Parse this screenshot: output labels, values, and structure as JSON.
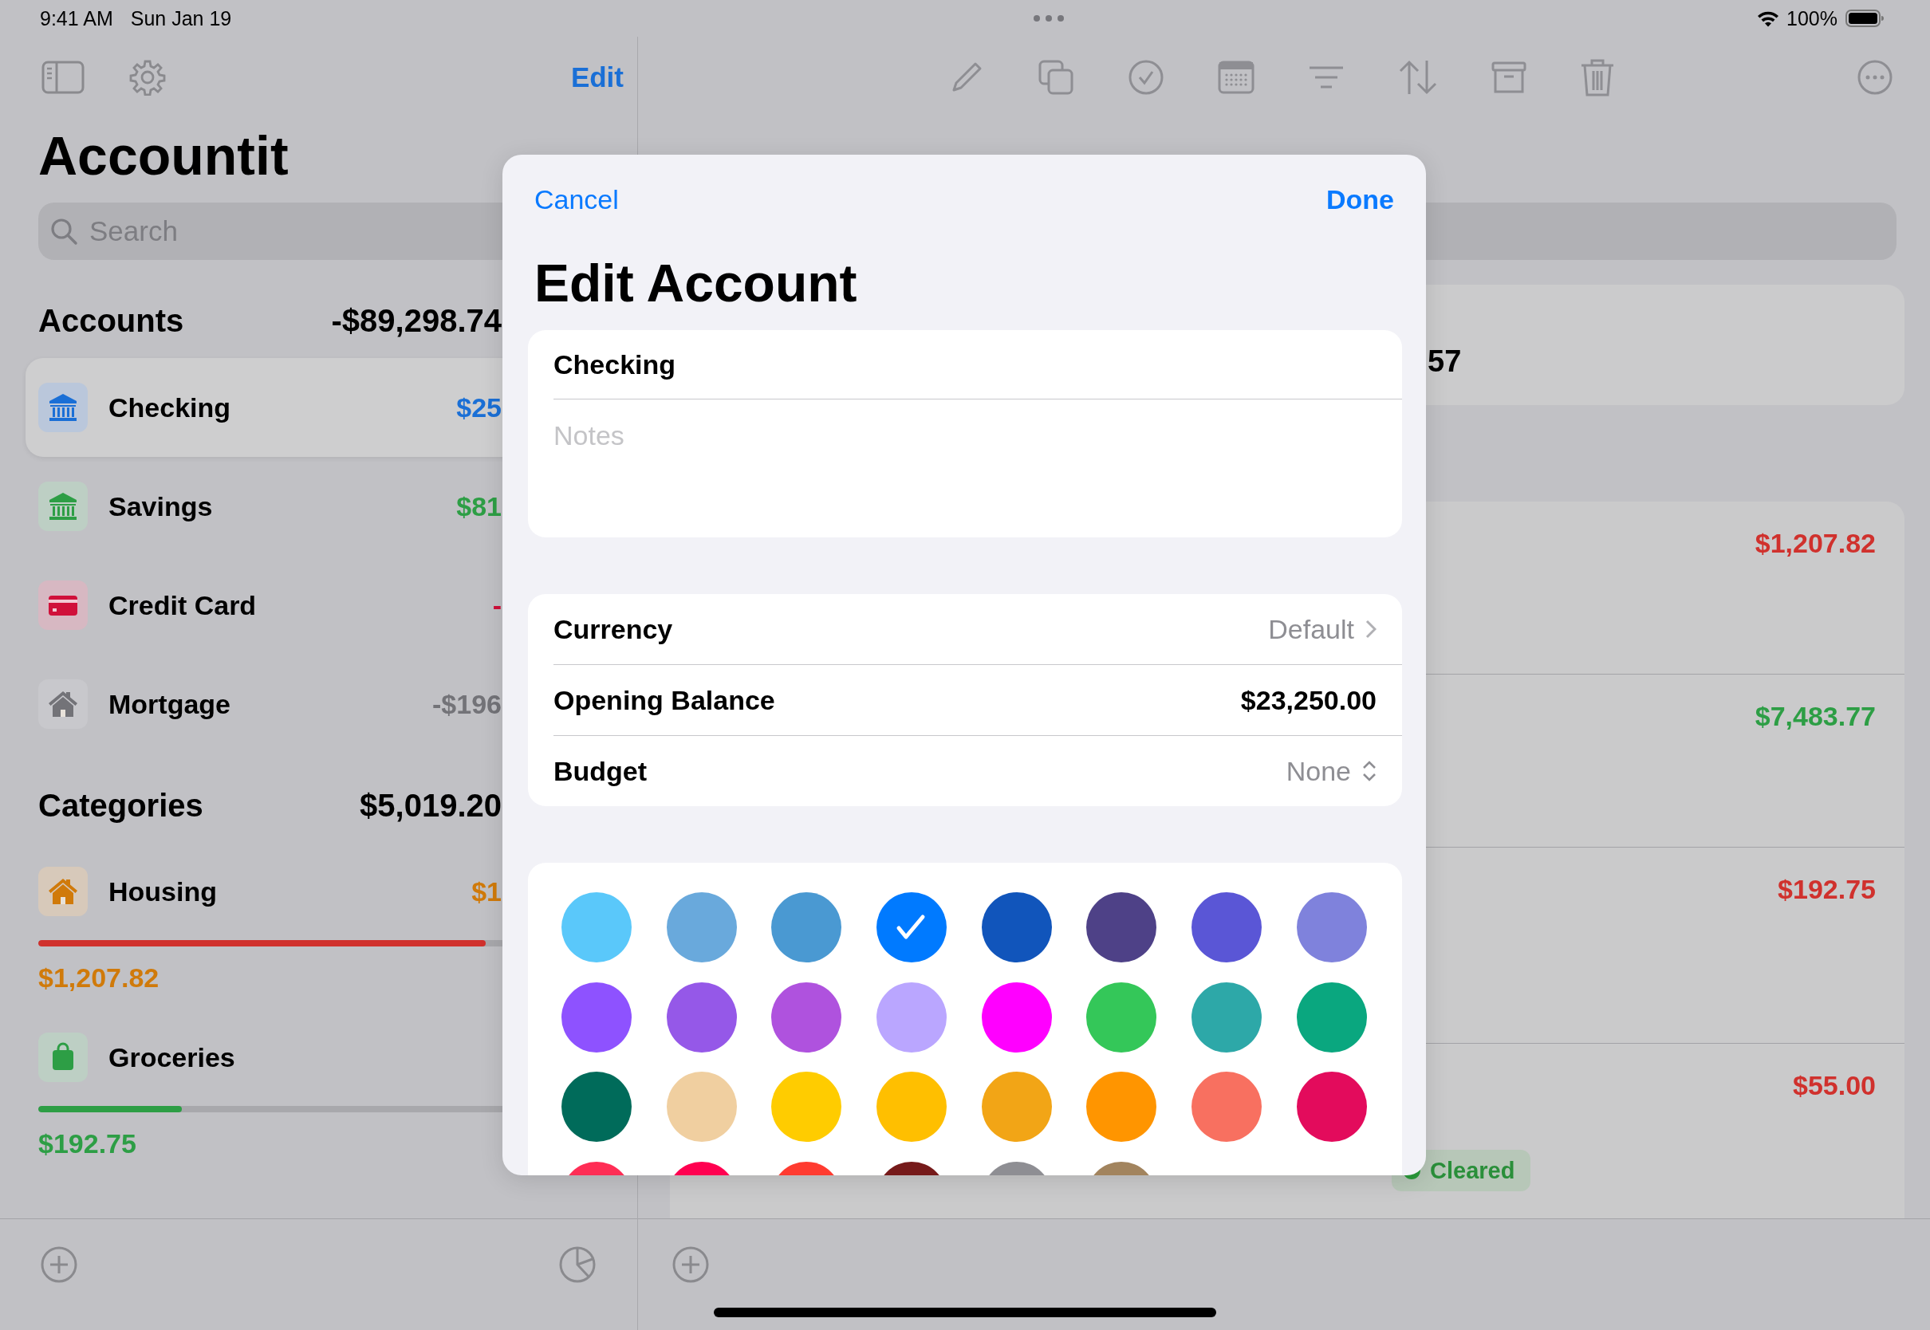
{
  "status_bar": {
    "time": "9:41 AM",
    "date": "Sun Jan 19",
    "battery": "100%"
  },
  "sidebar": {
    "edit": "Edit",
    "title": "Accountit",
    "search": {
      "placeholder": "Search"
    },
    "sections": [
      {
        "kind": "accounts",
        "title": "Accounts",
        "total": "-$89,298.74",
        "items": [
          {
            "name": "Checking",
            "amount": "$25",
            "kind": "bank",
            "color": "#1a6fd6",
            "selected": true
          },
          {
            "name": "Savings",
            "amount": "$81",
            "kind": "bank",
            "color": "#2d9e45",
            "selected": false
          },
          {
            "name": "Credit Card",
            "amount": "-",
            "kind": "card",
            "color": "#d0103a",
            "selected": false
          },
          {
            "name": "Mortgage",
            "amount": "-$196",
            "kind": "house",
            "color": "#737378",
            "selected": false
          }
        ]
      },
      {
        "kind": "categories",
        "title": "Categories",
        "total": "$5,019.20",
        "items": [
          {
            "name": "Housing",
            "amount": "$1",
            "kind": "house",
            "color": "#d07a0a",
            "selected": false,
            "level": 0.78,
            "over_budget": true,
            "spent": "$1,207.82"
          },
          {
            "name": "Groceries",
            "kind": "bag",
            "color": "#2d9e45",
            "selected": false,
            "level": 0.25,
            "over_budget": false,
            "spent": "$192.75"
          }
        ]
      }
    ]
  },
  "detail": {
    "balance": "57",
    "transactions": [
      {
        "kind": "expense",
        "amount": "$1,207.82"
      },
      {
        "kind": "income",
        "amount": "$7,483.77"
      },
      {
        "kind": "expense",
        "amount": "$192.75"
      },
      {
        "kind": "expense",
        "amount": "$55.00",
        "status": "Cleared"
      }
    ]
  },
  "modal": {
    "cancel": "Cancel",
    "done": "Done",
    "title": "Edit Account",
    "name": "Checking",
    "notes": {
      "placeholder": "Notes"
    },
    "rows": [
      {
        "kind": "link",
        "label": "Currency",
        "value": "Default"
      },
      {
        "kind": "field",
        "label": "Opening Balance",
        "value": "$23,250.00"
      },
      {
        "kind": "menu",
        "label": "Budget",
        "value": "None"
      }
    ],
    "colors": [
      {
        "color": "#5ac8fa",
        "selected": false
      },
      {
        "color": "#69a9dc",
        "selected": false
      },
      {
        "color": "#4a99d2",
        "selected": false
      },
      {
        "color": "#007aff",
        "selected": true
      },
      {
        "color": "#1155bb",
        "selected": false
      },
      {
        "color": "#4e4187",
        "selected": false
      },
      {
        "color": "#5a56d6",
        "selected": false
      },
      {
        "color": "#7f82dc",
        "selected": false
      },
      {
        "color": "#8e52ff",
        "selected": false
      },
      {
        "color": "#9558e8",
        "selected": false
      },
      {
        "color": "#af52de",
        "selected": false
      },
      {
        "color": "#baa6ff",
        "selected": false
      },
      {
        "color": "#ff00ff",
        "selected": false
      },
      {
        "color": "#34c759",
        "selected": false
      },
      {
        "color": "#2da8a8",
        "selected": false
      },
      {
        "color": "#0aa77f",
        "selected": false
      },
      {
        "color": "#006b5a",
        "selected": false
      },
      {
        "color": "#f0cfa0",
        "selected": false
      },
      {
        "color": "#ffcc00",
        "selected": false
      },
      {
        "color": "#ffbf00",
        "selected": false
      },
      {
        "color": "#f2a516",
        "selected": false
      },
      {
        "color": "#ff9500",
        "selected": false
      },
      {
        "color": "#f87060",
        "selected": false
      },
      {
        "color": "#e30b5c",
        "selected": false
      },
      {
        "color": "#ff2d55"
      },
      {
        "color": "#ff0050"
      },
      {
        "color": "#ff3b30"
      },
      {
        "color": "#761a1a"
      },
      {
        "color": "#8e8e93"
      },
      {
        "color": "#a2845e"
      }
    ]
  }
}
